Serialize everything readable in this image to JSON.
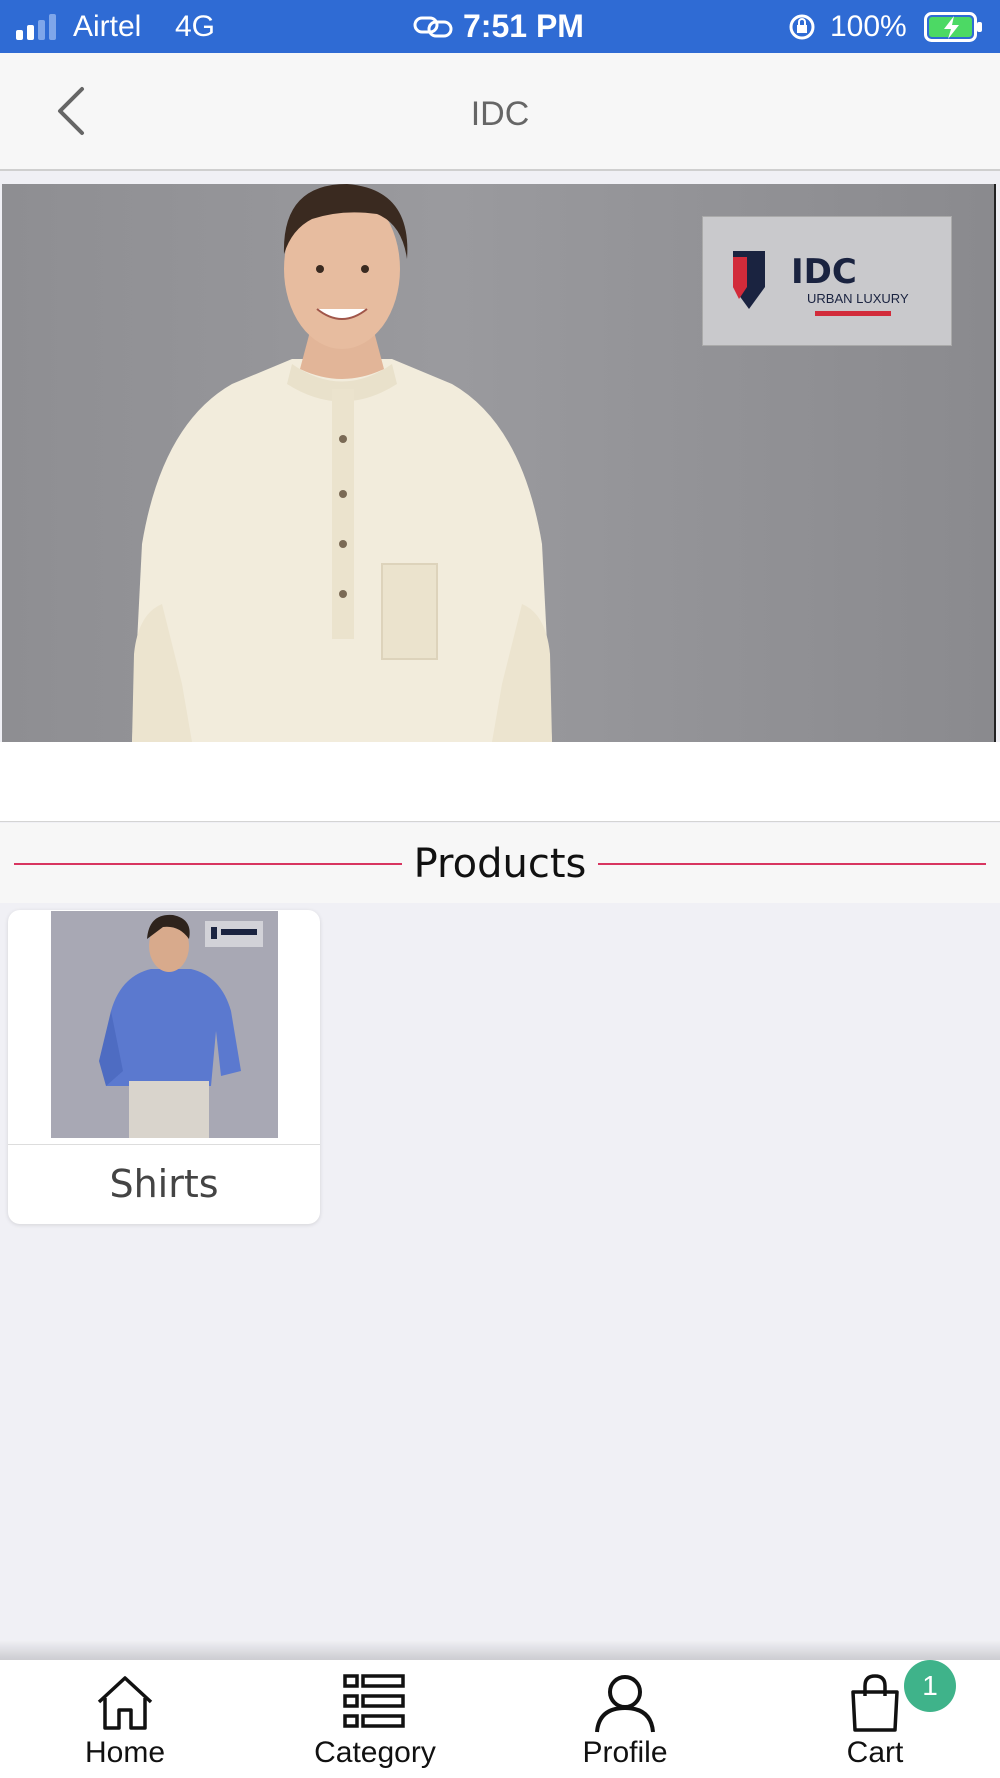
{
  "status_bar": {
    "carrier": "Airtel",
    "network": "4G",
    "time": "7:51 PM",
    "battery": "100%",
    "signal_bars": 2,
    "bg_color": "#2f6bd4"
  },
  "nav": {
    "title": "IDC",
    "back_icon": "chevron-left-icon"
  },
  "banner": {
    "logo_text": "IDC",
    "logo_tagline": "URBAN LUXURY"
  },
  "products": {
    "header": "Products",
    "accent_color": "#d83560",
    "items": [
      {
        "name": "Shirts"
      }
    ]
  },
  "tab_bar": {
    "tabs": [
      {
        "label": "Home",
        "icon": "home-icon"
      },
      {
        "label": "Category",
        "icon": "list-icon"
      },
      {
        "label": "Profile",
        "icon": "user-icon"
      },
      {
        "label": "Cart",
        "icon": "bag-icon",
        "badge": "1"
      }
    ],
    "badge_color": "#3fb38a"
  }
}
